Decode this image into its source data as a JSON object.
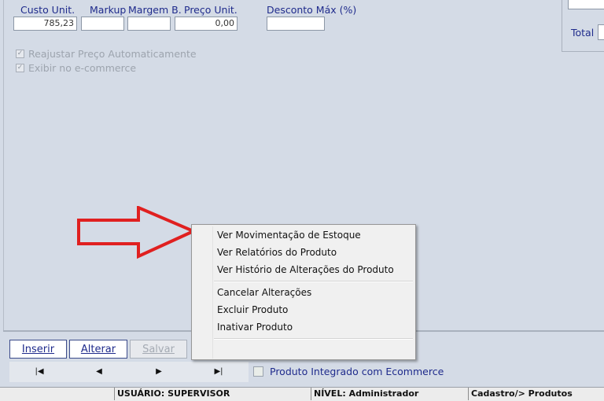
{
  "pricing": {
    "custo_label": "Custo Unit.",
    "custo_value": "785,23",
    "markup_label": "Markup",
    "margem_label": "Margem B.",
    "preco_label": "Preço Unit.",
    "preco_value": "0,00",
    "desconto_label": "Desconto Máx (%)"
  },
  "options": {
    "reajustar": "Reajustar Preço Automaticamente",
    "exibir": "Exibir no e-commerce"
  },
  "right_panel": {
    "total_label": "Total"
  },
  "context_menu": {
    "items": [
      "Ver Movimentação de Estoque",
      "Ver Relatórios do Produto",
      "Ver Histório de Alterações do Produto",
      "Cancelar Alterações",
      "Excluir Produto",
      "Inativar Produto"
    ]
  },
  "buttons": {
    "inserir": "Inserir",
    "alterar": "Alterar",
    "salvar": "Salvar"
  },
  "navigator": {
    "first": "first-record-icon",
    "prior": "prior-record-icon",
    "next": "next-record-icon",
    "last": "last-record-icon"
  },
  "integration": {
    "label": "Produto Integrado com Ecommerce"
  },
  "status_bar": {
    "usuario": "USUÁRIO: SUPERVISOR",
    "nivel": "NÍVEL: Administrador",
    "path": "Cadastro/> Produtos"
  },
  "colors": {
    "background": "#d4dbe6",
    "label_text": "#1f2b8c",
    "arrow": "#e02020"
  }
}
